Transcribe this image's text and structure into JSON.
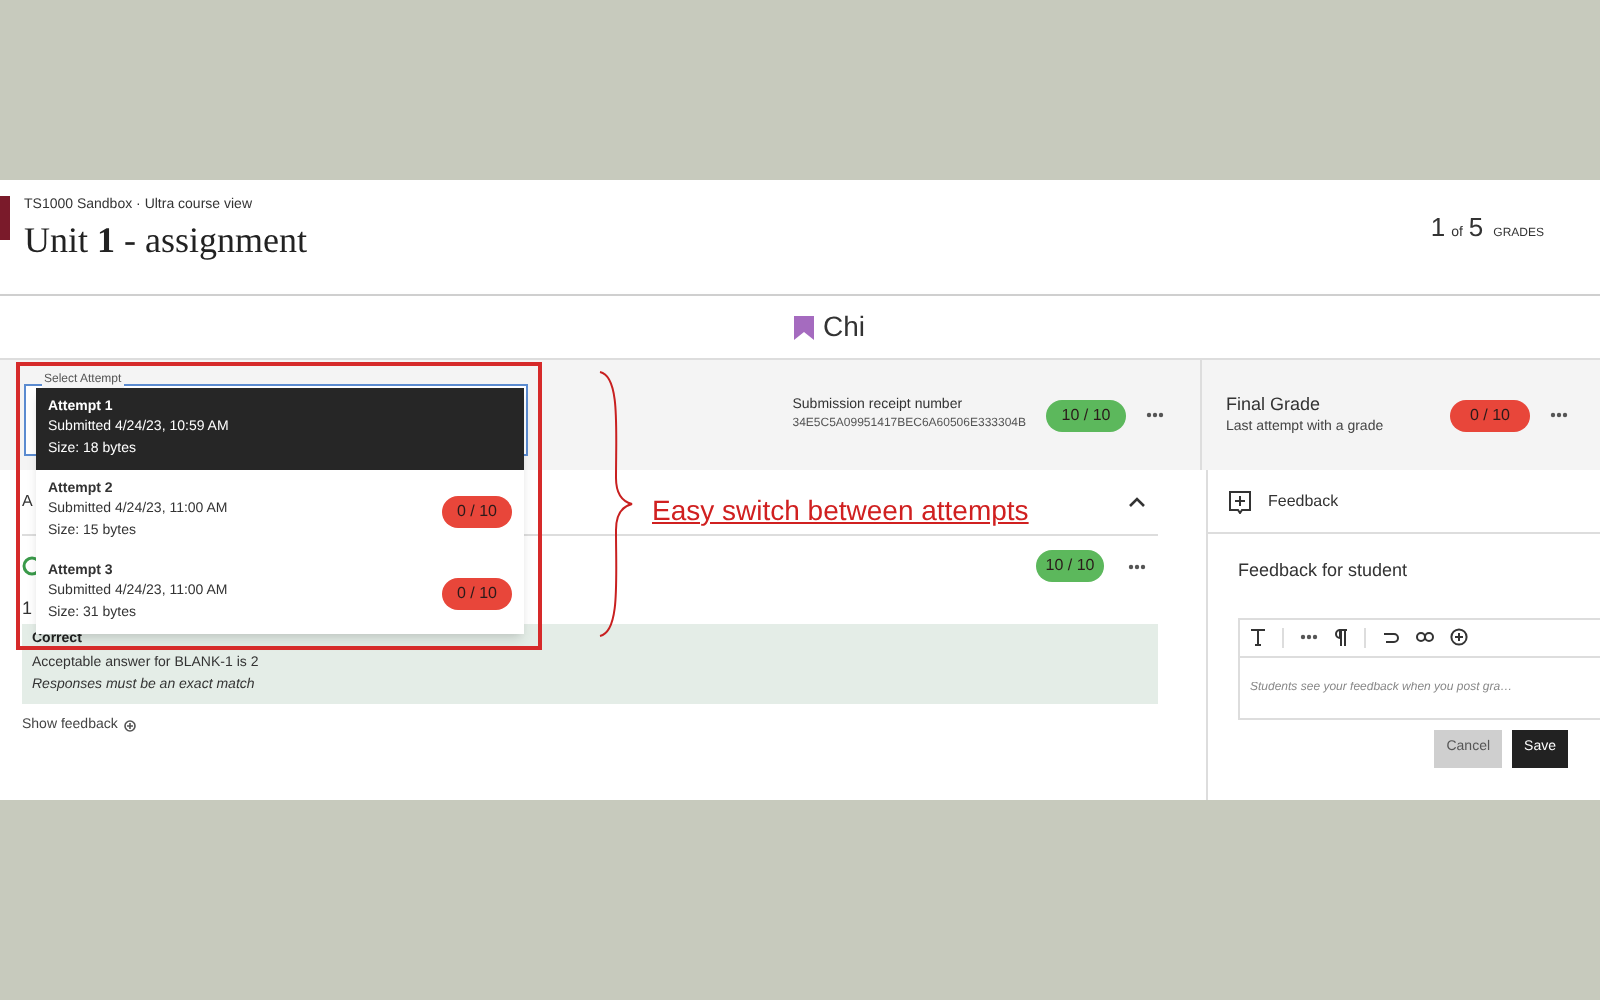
{
  "header": {
    "breadcrumb": "TS1000 Sandbox · Ultra course view",
    "title": "Unit **1** - assignment",
    "counter": {
      "current": "1",
      "of": "of",
      "total": "5",
      "label": "GRADES"
    }
  },
  "student": {
    "name": "Chi"
  },
  "attempt_select": {
    "label": "Select Attempt",
    "options": [
      {
        "title": "Attempt 1",
        "submitted": "Submitted 4/24/23, 10:59 AM",
        "size": "Size: 18 bytes",
        "selected": true
      },
      {
        "title": "Attempt 2",
        "submitted": "Submitted 4/24/23, 11:00 AM",
        "size": "Size: 15 bytes",
        "selected": false,
        "grade": {
          "text": "0 / 10",
          "color": "#e8463a"
        }
      },
      {
        "title": "Attempt 3",
        "submitted": "Submitted 4/24/23, 11:00 AM",
        "size": "Size: 31 bytes",
        "selected": false,
        "grade": {
          "text": "0 / 10",
          "color": "#e8463a"
        }
      }
    ]
  },
  "submission": {
    "receipt_label": "Submission receipt number",
    "receipt": "34E5C5A09951417BEC6A60506E333304B",
    "grade": {
      "text": "10 / 10",
      "color": "#5cb85c"
    }
  },
  "final_grade": {
    "title": "Final Grade",
    "subtitle": "Last attempt with a grade",
    "grade": {
      "text": "0 / 10",
      "color": "#e8463a"
    }
  },
  "question": {
    "heading": "A",
    "grade": {
      "text": "10 / 10",
      "color": "#5cb85c"
    },
    "number": "1",
    "result": {
      "title": "Correct",
      "lines": [
        {
          "text": "Acceptable answer for BLANK-1 is 2",
          "kind": "answer"
        },
        {
          "text": "Responses must be an exact match",
          "kind": "rule"
        }
      ]
    },
    "show_feedback": "Show feedback"
  },
  "feedback_panel": {
    "tab": "Feedback",
    "heading": "Feedback for student",
    "placeholder": "Students see your feedback when you post gra…",
    "buttons": [
      {
        "label": "Cancel",
        "kind": "secondary"
      },
      {
        "label": "Save",
        "kind": "primary"
      }
    ]
  },
  "annotation": {
    "text": "Easy switch between attempts"
  }
}
